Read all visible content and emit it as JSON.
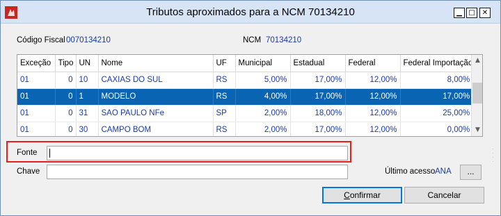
{
  "window": {
    "title": "Tributos aproximados para a NCM 70134210",
    "minimize_glyph": "▁",
    "maximize_glyph": "□",
    "close_glyph": "✕"
  },
  "header": {
    "codigo_fiscal_label": "Código Fiscal",
    "codigo_fiscal_value": "0070134210",
    "ncm_label": "NCM",
    "ncm_value": "70134210"
  },
  "table": {
    "columns": [
      "Exceção",
      "Tipo",
      "UN",
      "Nome",
      "UF",
      "Municipal",
      "Estadual",
      "Federal",
      "Federal Importação"
    ],
    "rows": [
      [
        "01",
        "0",
        "10",
        "CAXIAS DO SUL",
        "RS",
        "5,00%",
        "17,00%",
        "12,00%",
        "8,00%"
      ],
      [
        "01",
        "0",
        "1",
        "MODELO",
        "RS",
        "4,00%",
        "17,00%",
        "12,00%",
        "17,00%"
      ],
      [
        "01",
        "0",
        "31",
        "SAO PAULO NFe",
        "SP",
        "2,00%",
        "18,00%",
        "12,00%",
        "25,00%"
      ],
      [
        "01",
        "0",
        "30",
        "CAMPO BOM",
        "RS",
        "2,00%",
        "17,00%",
        "12,00%",
        "0,00%"
      ]
    ],
    "selected_row": 1
  },
  "form": {
    "fonte_label": "Fonte",
    "fonte_value": "",
    "chave_label": "Chave",
    "chave_value": "",
    "ultimo_acesso_label": "Último acesso",
    "ultimo_acesso_value": "ANA",
    "browse_label": "..."
  },
  "buttons": {
    "confirmar_first": "C",
    "confirmar_rest": "onfirmar",
    "cancelar": "Cancelar"
  },
  "colors": {
    "selection": "#0a64b4",
    "value_text": "#1a3aa8",
    "highlight_box": "#e8201c",
    "title_bar": "#d6e4f5"
  }
}
